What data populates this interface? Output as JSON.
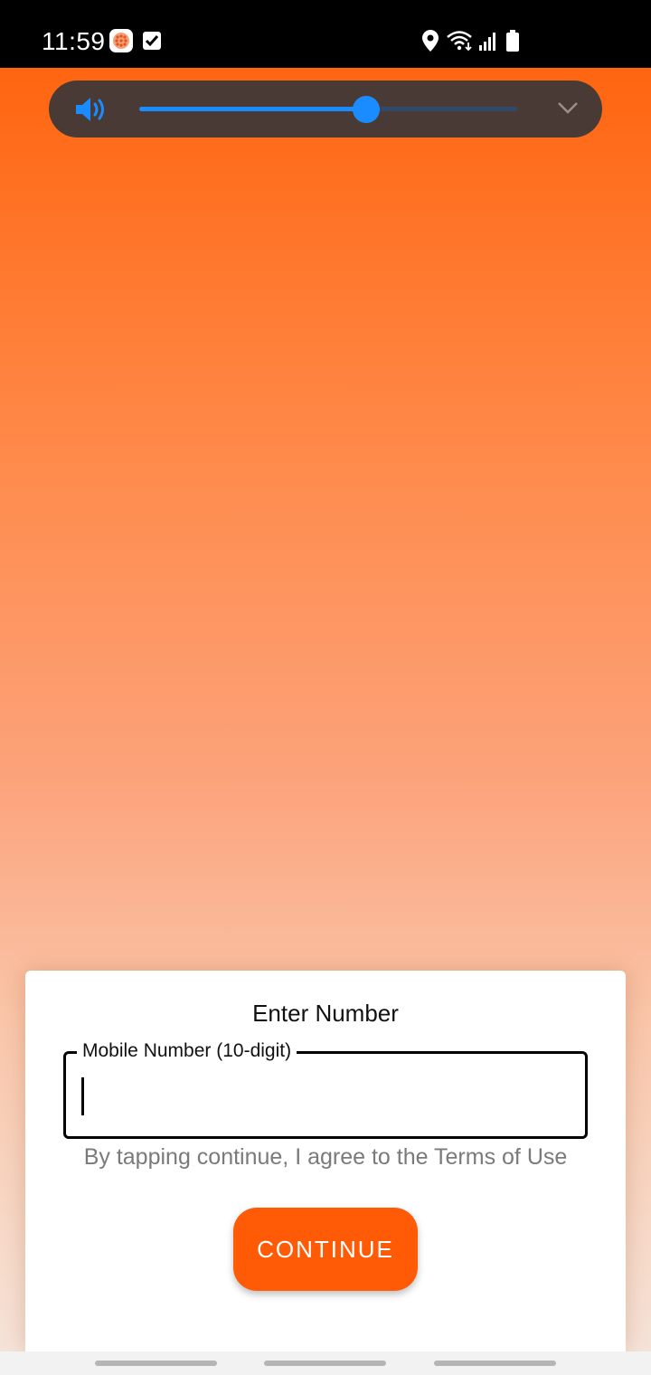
{
  "status_bar": {
    "time": "11:59",
    "left_icons": [
      "app-notification-icon",
      "checkbox-notification-icon"
    ],
    "right_icons": [
      "location-icon",
      "wifi-icon",
      "signal-icon",
      "battery-icon"
    ]
  },
  "volume_panel": {
    "icon": "speaker-icon",
    "level_fraction": 0.6,
    "expand_icon": "chevron-down-icon",
    "accent_color": "#1a8cff"
  },
  "card": {
    "title": "Enter Number",
    "mobile_field": {
      "label": "Mobile Number (10-digit)",
      "value": "",
      "placeholder": ""
    },
    "terms_text": "By tapping continue, I agree to the Terms of Use",
    "continue_label": "CONTINUE",
    "button_color": "#ff5a05"
  },
  "nav_bar": {
    "buttons": [
      "recents-button",
      "home-button",
      "back-button"
    ]
  }
}
